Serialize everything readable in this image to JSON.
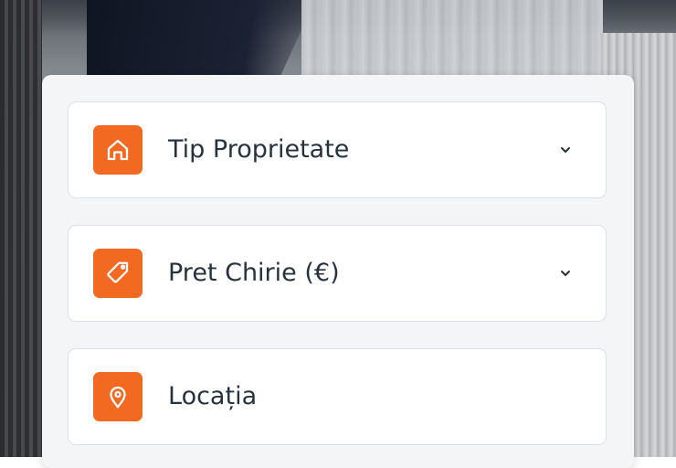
{
  "filters": [
    {
      "label": "Tip Proprietate",
      "icon": "home-icon",
      "has_dropdown": true
    },
    {
      "label": "Pret Chirie (€)",
      "icon": "price-tag-icon",
      "has_dropdown": true
    },
    {
      "label": "Locația",
      "icon": "location-pin-icon",
      "has_dropdown": false
    }
  ],
  "colors": {
    "accent": "#f26a21",
    "text": "#26333f",
    "card": "#f4f5f7",
    "field_border": "#d9e2ea"
  }
}
